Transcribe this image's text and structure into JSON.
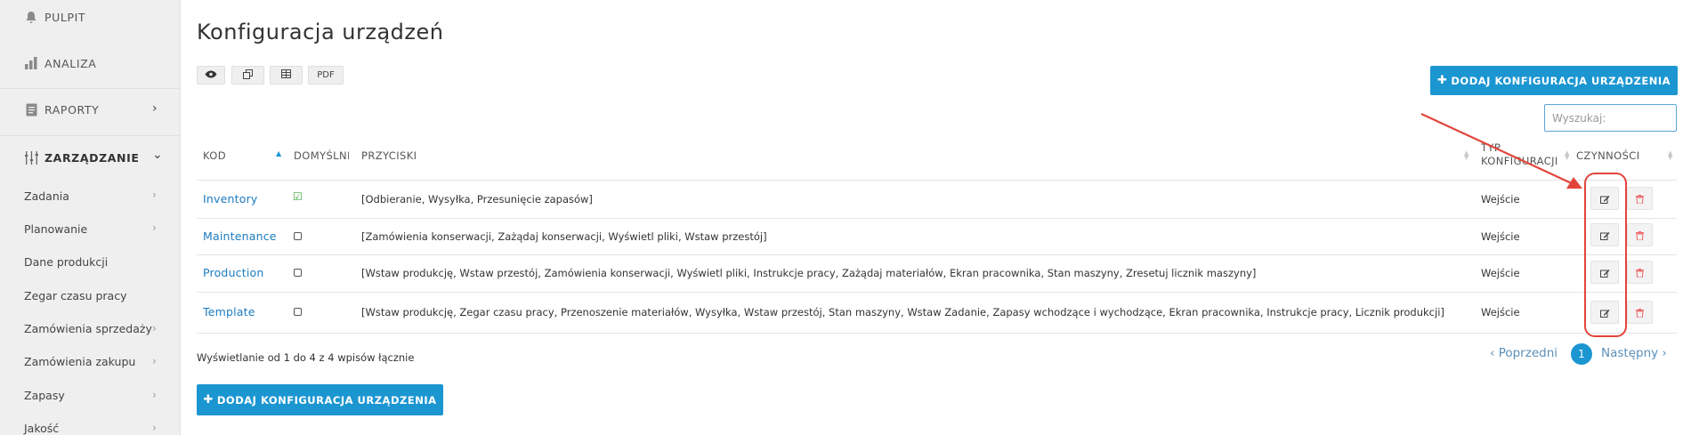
{
  "sidebar": {
    "top_items": [
      {
        "label": "PULPIT",
        "icon": "bell-icon"
      },
      {
        "label": "ANALIZA",
        "icon": "bar-chart-icon"
      },
      {
        "label": "RAPORTY",
        "icon": "document-icon"
      },
      {
        "label": "ZARZĄDZANIE",
        "icon": "sliders-icon"
      }
    ],
    "sub_items": [
      {
        "label": "Zadania"
      },
      {
        "label": "Planowanie"
      },
      {
        "label": "Dane produkcji"
      },
      {
        "label": "Zegar czasu pracy"
      },
      {
        "label": "Zamówienia sprzedaży"
      },
      {
        "label": "Zamówienia zakupu"
      },
      {
        "label": "Zapasy"
      },
      {
        "label": "Jakość"
      }
    ]
  },
  "page": {
    "title": "Konfiguracja urządzeń",
    "export_buttons": [
      "eye-icon",
      "copy-icon",
      "table-icon",
      "PDF"
    ],
    "add_button_label": "DODAJ KONFIGURACJA URZĄDZENIA",
    "search_placeholder": "Wyszukaj:"
  },
  "table": {
    "columns": [
      "KOD",
      "DOMYŚLNE",
      "PRZYCISKI",
      "TYP KONFIGURACJI",
      "CZYNNOŚCI"
    ],
    "sorted_column": "KOD",
    "rows": [
      {
        "code": "Inventory",
        "default": true,
        "buttons": "[Odbieranie, Wysyłka, Przesunięcie zapasów]",
        "type": "Wejście"
      },
      {
        "code": "Maintenance",
        "default": false,
        "buttons": "[Zamówienia konserwacji, Zażądaj konserwacji, Wyświetl pliki, Wstaw przestój]",
        "type": "Wejście"
      },
      {
        "code": "Production",
        "default": false,
        "buttons": "[Wstaw produkcję, Wstaw przestój, Zamówienia konserwacji, Wyświetl pliki, Instrukcje pracy, Zażądaj materiałów, Ekran pracownika, Stan maszyny, Zresetuj licznik maszyny]",
        "type": "Wejście"
      },
      {
        "code": "Template",
        "default": false,
        "buttons": "[Wstaw produkcję, Zegar czasu pracy, Przenoszenie materiałów, Wysyłka, Wstaw przestój, Stan maszyny, Wstaw Zadanie, Zapasy wchodzące i wychodzące, Ekran pracownika, Instrukcje pracy, Licznik produkcji]",
        "type": "Wejście"
      }
    ],
    "actions": [
      "edit-icon",
      "trash-icon"
    ]
  },
  "footer": {
    "info": "Wyświetlanie od 1 do 4 z 4 wpisów łącznie",
    "prev": "‹ Poprzedni",
    "page": "1",
    "next": "Następny ›"
  },
  "annotation": {
    "color": "#e3443a"
  }
}
